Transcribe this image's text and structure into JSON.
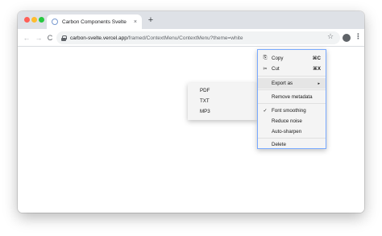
{
  "browser": {
    "tab_title": "Carbon Components Svelte",
    "tab_close": "×",
    "new_tab": "+",
    "back": "←",
    "forward": "→",
    "reload": "C",
    "url_host": "carbon-svelte.vercel.app",
    "url_path": "/framed/ContextMenu/ContextMenu?theme=white",
    "star": "☆",
    "menu": "⋮"
  },
  "context_menu": {
    "items": [
      {
        "label": "Copy",
        "shortcut": "⌘C",
        "icon": "copy-icon",
        "glyph": "⎘"
      },
      {
        "label": "Cut",
        "shortcut": "⌘X",
        "icon": "scissors-icon",
        "glyph": "✂"
      },
      {
        "label": "Export as",
        "arrow": "▸"
      },
      {
        "label": "Remove metadata"
      },
      {
        "label": "Font smoothing",
        "checked": true,
        "glyph": "✓"
      },
      {
        "label": "Reduce noise"
      },
      {
        "label": "Auto-sharpen"
      },
      {
        "label": "Delete"
      }
    ]
  },
  "submenu": {
    "items": [
      {
        "label": "PDF"
      },
      {
        "label": "TXT"
      },
      {
        "label": "MP3"
      }
    ]
  },
  "colors": {
    "menu_bg": "#f4f4f4",
    "menu_hover": "#e5e5e5",
    "focus_border": "#78a9ff"
  }
}
